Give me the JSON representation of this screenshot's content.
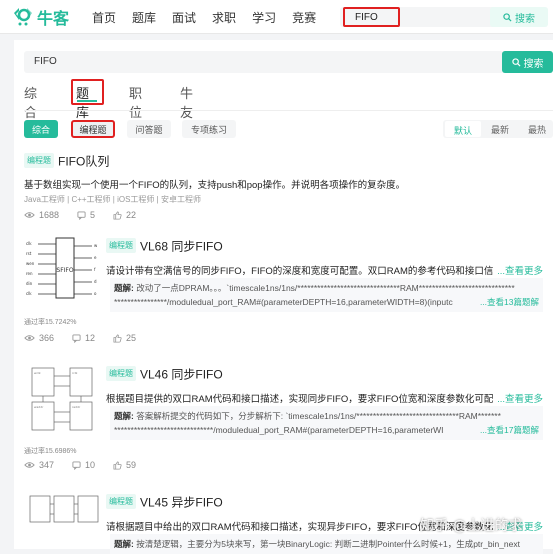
{
  "header": {
    "logo_text": "牛客",
    "nav": [
      "首页",
      "题库",
      "面试",
      "求职",
      "学习",
      "竞赛"
    ],
    "search_value": "FIFO",
    "search_button": "搜索"
  },
  "search": {
    "value": "FIFO",
    "button": "搜索"
  },
  "tabs": [
    "综合",
    "题库",
    "职位",
    "牛友"
  ],
  "filters": {
    "chips": [
      "综合",
      "编程题",
      "问答题",
      "专项练习"
    ],
    "sort": [
      "默认",
      "最新",
      "最热"
    ]
  },
  "results": [
    {
      "tag": "编程题",
      "title": "FIFO队列",
      "desc": "基于数组实现一个使用一个FIFO的队列，支持push和pop操作。并说明各项操作的复杂度。",
      "meta": [
        "Java工程师",
        "C++工程师",
        "iOS工程师",
        "安卓工程师"
      ],
      "views": "1688",
      "comments": "5",
      "likes": "22"
    },
    {
      "tag": "编程题",
      "title": "VL68 同步FIFO",
      "desc": "请设计带有空满信号的同步FIFO，FIFO的深度和宽度可配置。双口RAM的参考代码和接口信",
      "desc_more": "...查看更多",
      "sol_label": "题解:",
      "sol_line1": "改动了一点DPRAM。。。`timescale1ns/1ns/*******************************RAM*****************************",
      "sol_line2": "****************/moduledual_port_RAM#(parameterDEPTH=16,parameterWIDTH=8)(inputc",
      "sol_more": "...查看13篇题解",
      "pass_rate": "通过率15.7242%",
      "views": "366",
      "comments": "12",
      "likes": "25"
    },
    {
      "tag": "编程题",
      "title": "VL46 同步FIFO",
      "desc": "根据题目提供的双口RAM代码和接口描述，实现同步FIFO，要求FIFO位宽和深度参数化可配",
      "desc_more": "...查看更多",
      "sol_label": "题解:",
      "sol_line1": "答案解析提交的代码如下，分步解析下: `timescale1ns/1ns/*******************************RAM*******",
      "sol_line2": "******************************/moduledual_port_RAM#(parameterDEPTH=16,parameterWI",
      "sol_more": "...查看17篇题解",
      "pass_rate": "通过率15.6986%",
      "views": "347",
      "comments": "10",
      "likes": "59"
    },
    {
      "tag": "编程题",
      "title": "VL45 异步FIFO",
      "desc": "请根据题目中给出的双口RAM代码和接口描述，实现异步FIFO，要求FIFO位宽和深度参数化",
      "desc_more": "...查看更多",
      "sol_label": "题解:",
      "sol_line1": "按清楚逻辑，主要分为5块来写，第一块BinaryLogic: 判断二进制Pointer什么时候+1，生成ptr_bin_next"
    }
  ],
  "thumb_label": "SFIFO",
  "watermark": "知乎 @上进的求",
  "colors": {
    "brand": "#25bb9b",
    "highlight": "#e02020"
  }
}
